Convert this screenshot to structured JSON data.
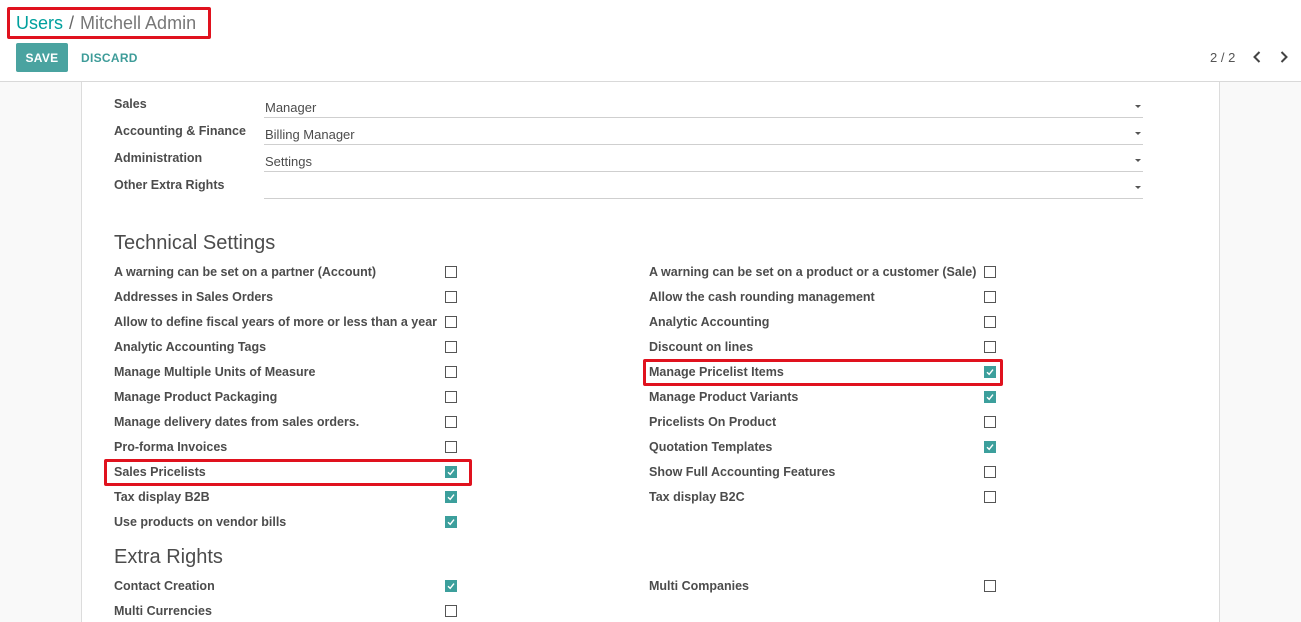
{
  "breadcrumb": {
    "parent": "Users",
    "separator": "/",
    "current": "Mitchell Admin"
  },
  "buttons": {
    "save": "SAVE",
    "discard": "DISCARD"
  },
  "pager": {
    "value": "2 / 2"
  },
  "colors": {
    "accent": "#00A09D",
    "button": "#4aa3a0",
    "checked": "#3c9f9c",
    "highlight": "#e0121e"
  },
  "applications": [
    {
      "label": "Sales",
      "value": "Manager"
    },
    {
      "label": "Accounting & Finance",
      "value": "Billing Manager"
    },
    {
      "label": "Administration",
      "value": "Settings"
    },
    {
      "label": "Other Extra Rights",
      "value": ""
    }
  ],
  "technical": {
    "title": "Technical Settings",
    "left": [
      {
        "label": "A warning can be set on a partner (Account)",
        "checked": false
      },
      {
        "label": "Addresses in Sales Orders",
        "checked": false
      },
      {
        "label": "Allow to define fiscal years of more or less than a year",
        "checked": false
      },
      {
        "label": "Analytic Accounting Tags",
        "checked": false
      },
      {
        "label": "Manage Multiple Units of Measure",
        "checked": false
      },
      {
        "label": "Manage Product Packaging",
        "checked": false
      },
      {
        "label": "Manage delivery dates from sales orders.",
        "checked": false
      },
      {
        "label": "Pro-forma Invoices",
        "checked": false
      },
      {
        "label": "Sales Pricelists",
        "checked": true
      },
      {
        "label": "Tax display B2B",
        "checked": true
      },
      {
        "label": "Use products on vendor bills",
        "checked": true
      }
    ],
    "right": [
      {
        "label": "A warning can be set on a product or a customer (Sale)",
        "checked": false
      },
      {
        "label": "Allow the cash rounding management",
        "checked": false
      },
      {
        "label": "Analytic Accounting",
        "checked": false
      },
      {
        "label": "Discount on lines",
        "checked": false
      },
      {
        "label": "Manage Pricelist Items",
        "checked": true
      },
      {
        "label": "Manage Product Variants",
        "checked": true
      },
      {
        "label": "Pricelists On Product",
        "checked": false
      },
      {
        "label": "Quotation Templates",
        "checked": true
      },
      {
        "label": "Show Full Accounting Features",
        "checked": false
      },
      {
        "label": "Tax display B2C",
        "checked": false
      }
    ]
  },
  "extra": {
    "title": "Extra Rights",
    "left": [
      {
        "label": "Contact Creation",
        "checked": true
      },
      {
        "label": "Multi Currencies",
        "checked": false
      }
    ],
    "right": [
      {
        "label": "Multi Companies",
        "checked": false
      }
    ]
  }
}
